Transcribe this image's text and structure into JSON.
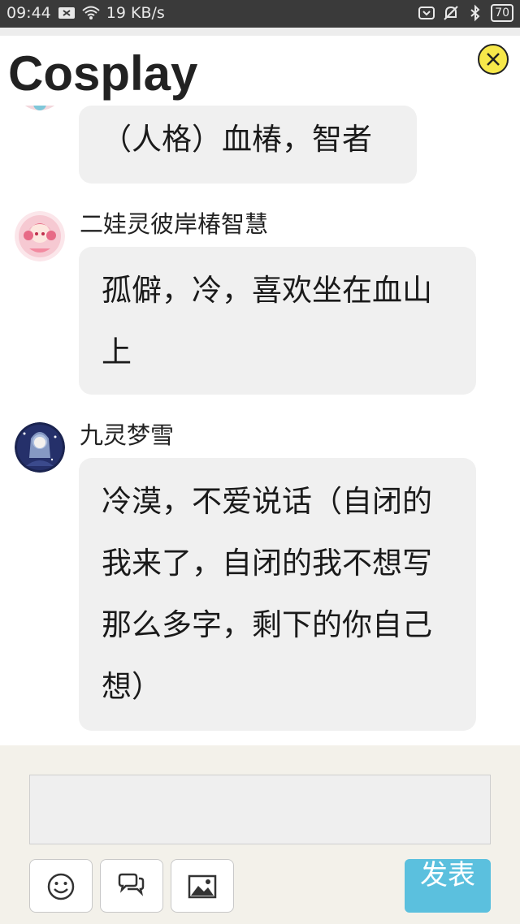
{
  "status_bar": {
    "time": "09:44",
    "network_speed": "19 KB/s",
    "battery": "70",
    "icons": [
      "close-notify-icon",
      "wifi-icon",
      "signal-icon",
      "mute-icon",
      "bluetooth-icon",
      "battery-icon"
    ]
  },
  "header": {
    "title": "Cosplay",
    "close_icon": "close-circle-icon"
  },
  "messages": [
    {
      "user": "",
      "text": "（人格）血椿，智者"
    },
    {
      "user": "二娃灵彼岸椿智慧",
      "text": "孤僻，冷，喜欢坐在血山上"
    },
    {
      "user": "九灵梦雪",
      "text": "冷漠，不爱说话（自闭的我来了，自闭的我不想写那么多字，剩下的你自己想）"
    }
  ],
  "composer": {
    "input_value": "",
    "buttons": [
      "emoji-icon",
      "chat-bubbles-icon",
      "image-icon"
    ],
    "send_label": "发表"
  },
  "colors": {
    "accent": "#5bc0de",
    "close_bg": "#f7e84a",
    "bubble_bg": "#f0f0f0",
    "footer_bg": "#f3f1ea"
  }
}
